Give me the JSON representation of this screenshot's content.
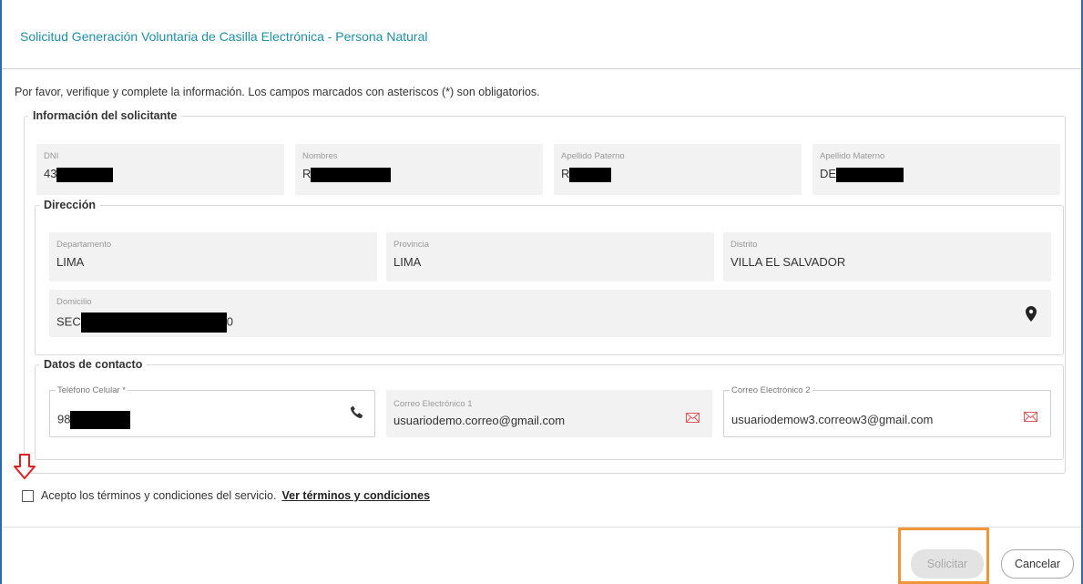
{
  "dialog": {
    "title": "Solicitud Generación Voluntaria de Casilla Electrónica - Persona Natural",
    "intro": "Por favor, verifique y complete la información. Los campos marcados con asteriscos (*) son obligatorios."
  },
  "applicant": {
    "legend": "Información del solicitante",
    "dni": {
      "label": "DNI",
      "value": "43"
    },
    "nombre": {
      "label": "Nombres",
      "value": "R"
    },
    "apellido_paterno": {
      "label": "Apellido Paterno",
      "value": "R"
    },
    "apellido_materno": {
      "label": "Apellido Materno",
      "value": "DE"
    }
  },
  "address": {
    "legend": "Dirección",
    "departamento": {
      "label": "Departamento",
      "value": "LIMA"
    },
    "provincia": {
      "label": "Provincia",
      "value": "LIMA"
    },
    "distrito": {
      "label": "Distrito",
      "value": "VILLA EL SALVADOR"
    },
    "domicilio": {
      "label": "Domicilio",
      "value": "SEC",
      "value_end": "0"
    }
  },
  "contact": {
    "legend": "Datos de contacto",
    "telefono": {
      "label": "Teléfono Celular *",
      "value": "98"
    },
    "correo1": {
      "label": "Correo Electrónico 1",
      "value": "usuariodemo.correo@gmail.com"
    },
    "correo2": {
      "label": "Correo Electrónico 2",
      "value": "usuariodemow3.correow3@gmail.com"
    }
  },
  "terms": {
    "label": "Acepto los términos y condiciones del servicio.",
    "link": "Ver términos y condiciones"
  },
  "buttons": {
    "submit": "Solicitar",
    "cancel": "Cancelar"
  },
  "icons": {
    "location": "location-pin-icon",
    "phone": "phone-icon",
    "mail": "mail-icon",
    "arrow": "arrow-down-icon"
  },
  "colors": {
    "title": "#1f8fa8",
    "frame": "#2b6cb0",
    "mail_icon": "#e05a5a",
    "arrow": "#e02020",
    "highlight": "#f0953a"
  }
}
